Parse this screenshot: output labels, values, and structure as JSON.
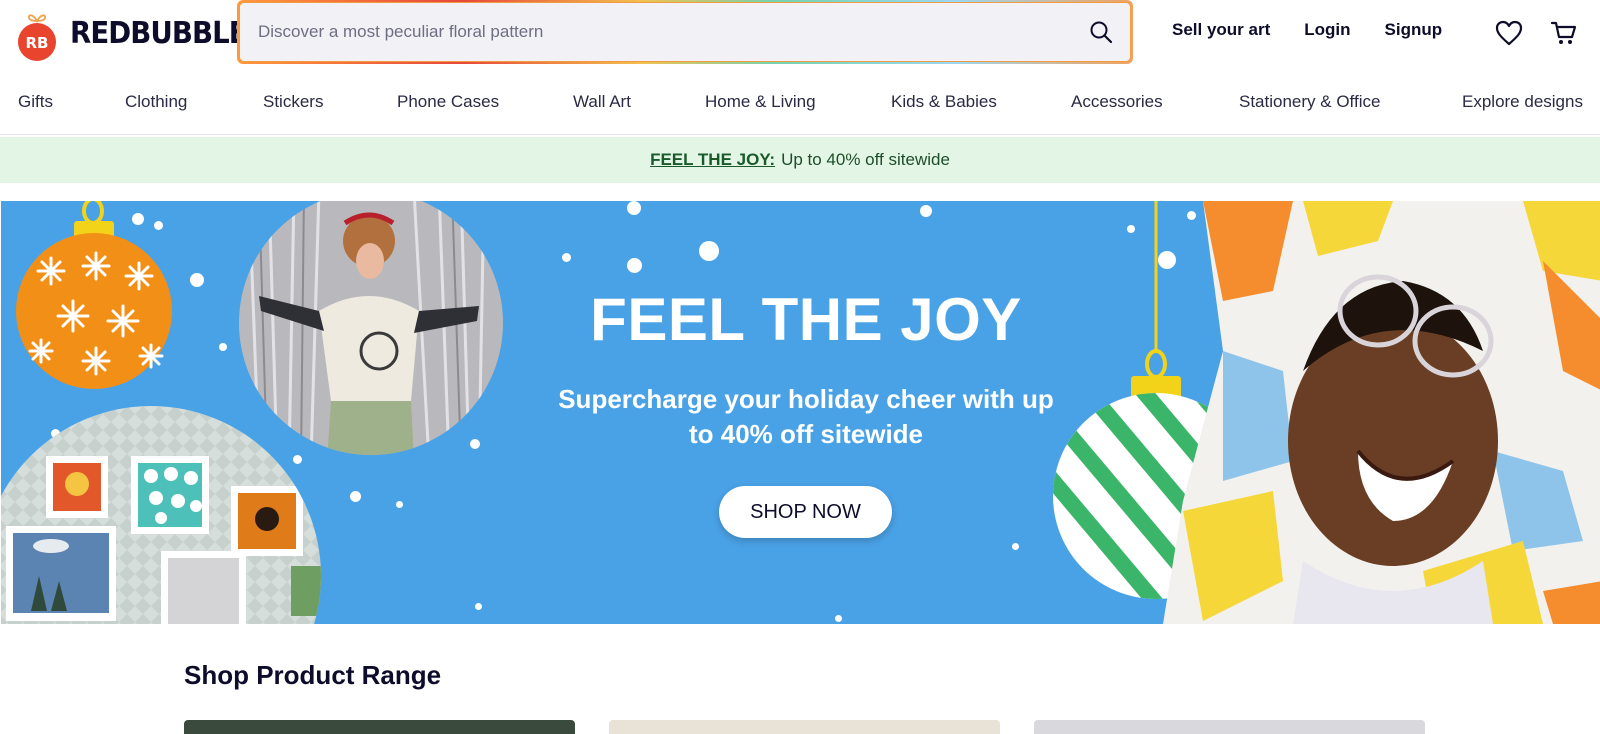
{
  "brand": {
    "name": "REDBUBBLE",
    "color": "#e8442e"
  },
  "search": {
    "placeholder": "Discover a most peculiar floral pattern"
  },
  "header_links": {
    "sell": "Sell your art",
    "login": "Login",
    "signup": "Signup"
  },
  "nav": [
    "Gifts",
    "Clothing",
    "Stickers",
    "Phone Cases",
    "Wall Art",
    "Home & Living",
    "Kids & Babies",
    "Accessories",
    "Stationery & Office",
    "Explore designs"
  ],
  "promo": {
    "link": "FEEL THE JOY:",
    "text": "Up to 40% off sitewide"
  },
  "hero": {
    "title": "FEEL THE JOY",
    "subtitle": "Supercharge your holiday cheer with up to 40% off sitewide",
    "cta": "SHOP NOW",
    "background": "#4aa2e6"
  },
  "section": {
    "title": "Shop Product Range"
  },
  "icons": [
    "search-icon",
    "heart-icon",
    "cart-icon"
  ]
}
